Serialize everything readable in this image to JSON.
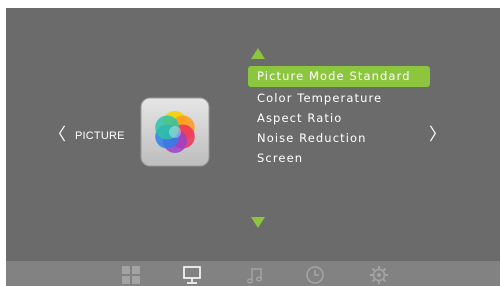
{
  "menu": {
    "category": "PICTURE",
    "prev_glyph": "〈",
    "next_glyph": "〉",
    "category_icon": "color-wheel-icon",
    "items": [
      {
        "label": "Picture Mode Standard",
        "selected": true
      },
      {
        "label": "Color Temperature",
        "selected": false
      },
      {
        "label": "Aspect Ratio",
        "selected": false
      },
      {
        "label": "Noise Reduction",
        "selected": false
      },
      {
        "label": "Screen",
        "selected": false
      }
    ]
  },
  "tabs": [
    {
      "icon": "source-grid-icon",
      "active": false
    },
    {
      "icon": "picture-monitor-icon",
      "active": true
    },
    {
      "icon": "music-note-icon",
      "active": false
    },
    {
      "icon": "clock-icon",
      "active": false
    },
    {
      "icon": "gear-icon",
      "active": false
    }
  ],
  "colors": {
    "background": "#6b6b6b",
    "bottom_bar": "#828282",
    "accent": "#8cc63f",
    "text": "#ffffff",
    "inactive_icon": "#a3a3a3"
  }
}
